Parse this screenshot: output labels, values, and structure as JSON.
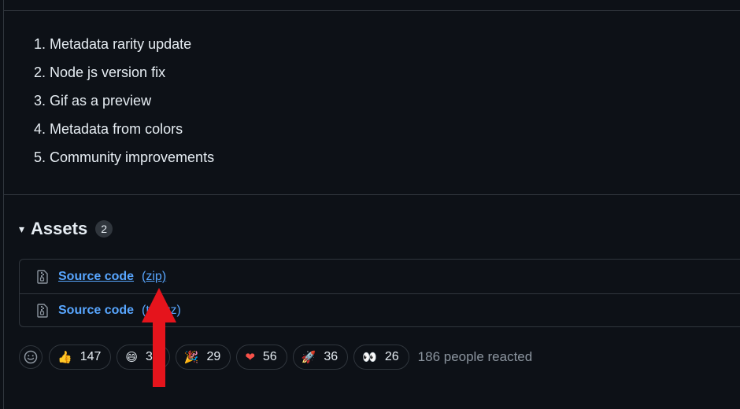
{
  "release_notes": [
    "1. Metadata rarity update",
    "2. Node js version fix",
    "3. Gif as a preview",
    "4. Metadata from colors",
    "5. Community improvements"
  ],
  "assets": {
    "title": "Assets",
    "count": "2",
    "items": [
      {
        "label": "Source code",
        "ext": "(zip)"
      },
      {
        "label": "Source code",
        "ext": "(tar.gz)"
      }
    ]
  },
  "reactions": {
    "items": [
      {
        "emoji": "👍",
        "icon": "thumbs-up-icon",
        "count": "147"
      },
      {
        "emoji": "😄",
        "icon": "laugh-icon",
        "count": "34"
      },
      {
        "emoji": "🎉",
        "icon": "hooray-icon",
        "count": "29"
      },
      {
        "emoji": "❤",
        "icon": "heart-icon",
        "count": "56"
      },
      {
        "emoji": "🚀",
        "icon": "rocket-icon",
        "count": "36"
      },
      {
        "emoji": "👀",
        "icon": "eyes-icon",
        "count": "26"
      }
    ],
    "summary": "186 people reacted"
  },
  "colors": {
    "background": "#0d1117",
    "border": "#30363d",
    "link": "#58a6ff",
    "annotation_arrow": "#e5141c"
  }
}
